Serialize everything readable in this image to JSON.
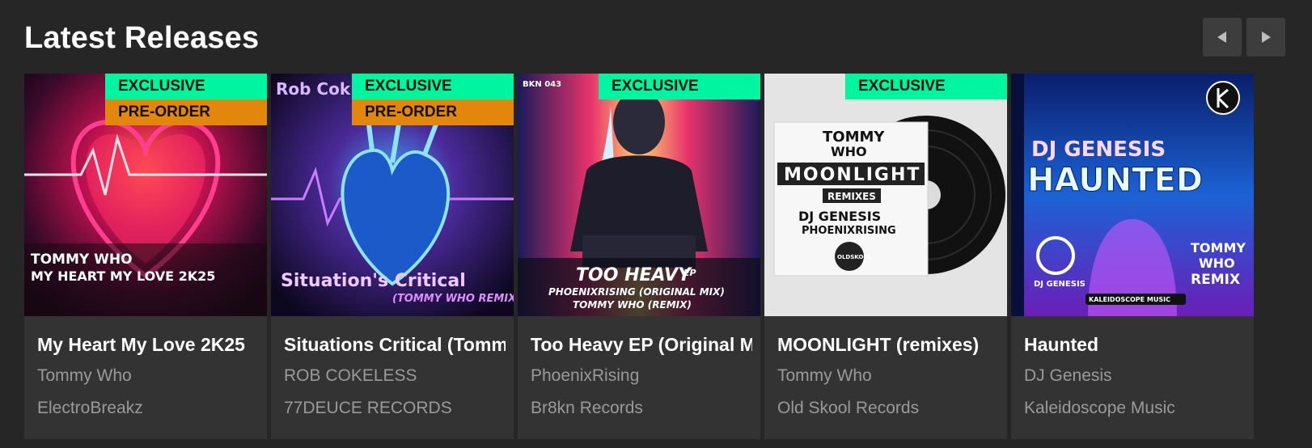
{
  "header": {
    "title": "Latest Releases",
    "prev_icon": "chevron-left-icon",
    "next_icon": "chevron-right-icon"
  },
  "colors": {
    "exclusive": "#00f5a0",
    "preorder": "#e3860c",
    "background": "#262626",
    "card": "#333333"
  },
  "releases": [
    {
      "title": "My Heart My Love 2K25",
      "artist": "Tommy Who",
      "label": "ElectroBreakz",
      "badges": [
        "EXCLUSIVE",
        "PRE-ORDER"
      ],
      "art_text": [
        "TOMMY WHO",
        "MY HEART MY LOVE 2K25"
      ]
    },
    {
      "title": "Situations Critical (Tommy Who Remix)",
      "artist": "ROB COKELESS",
      "label": "77DEUCE RECORDS",
      "badges": [
        "EXCLUSIVE",
        "PRE-ORDER"
      ],
      "art_text": [
        "Rob Cok",
        "Situation's Critical",
        "(TOMMY WHO REMIX)"
      ]
    },
    {
      "title": "Too Heavy EP (Original Mix)",
      "artist": "PhoenixRising",
      "label": "Br8kn Records",
      "badges": [
        "EXCLUSIVE"
      ],
      "art_text": [
        "BKN 043",
        "TOO HEAVY",
        "EP",
        "PHOENIXRISING (ORIGINAL MIX)",
        "TOMMY WHO (REMIX)"
      ]
    },
    {
      "title": "MOONLIGHT (remixes)",
      "artist": "Tommy Who",
      "label": "Old Skool Records",
      "badges": [
        "EXCLUSIVE"
      ],
      "art_text": [
        "TOMMY",
        "WHO",
        "MOONLIGHT",
        "REMIXES",
        "DJ GENESIS",
        "PHOENIXRISING",
        "OLDSKOOL"
      ]
    },
    {
      "title": "Haunted",
      "artist": "DJ Genesis",
      "label": "Kaleidoscope Music",
      "badges": [],
      "art_text": [
        "DJ GENESIS",
        "HAUNTED",
        "DJ GENESIS",
        "TOMMY",
        "WHO",
        "REMIX",
        "KALEIDOSCOPE MUSIC"
      ]
    }
  ]
}
